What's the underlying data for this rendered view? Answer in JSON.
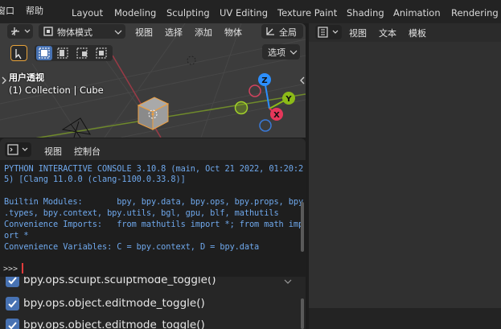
{
  "topbar": {
    "menus": [
      "窗口",
      "帮助"
    ],
    "workspaces": [
      "Layout",
      "Modeling",
      "Sculpting",
      "UV Editing",
      "Texture Paint",
      "Shading",
      "Animation",
      "Rendering"
    ]
  },
  "viewport": {
    "mode_label": "物体模式",
    "menus": [
      "视图",
      "选择",
      "添加",
      "物体"
    ],
    "global_label": "全局",
    "options_label": "选项",
    "view_name": "用户透视",
    "collection_info": "(1) Collection | Cube",
    "gizmo": {
      "z_label": "Z",
      "y_label": "Y",
      "x_label": "X"
    }
  },
  "console": {
    "menus": [
      "视图",
      "控制台"
    ],
    "lines": [
      "PYTHON INTERACTIVE CONSOLE 3.10.8 (main, Oct 21 2022, 01:20:2",
      "5) [Clang 11.0.0 (clang-1100.0.33.8)]",
      "",
      "Builtin Modules:       bpy, bpy.data, bpy.ops, bpy.props, bpy",
      ".types, bpy.context, bpy.utils, bgl, gpu, blf, mathutils",
      "Convenience Imports:   from mathutils import *; from math imp",
      "ort *",
      "Convenience Variables: C = bpy.context, D = bpy.data"
    ],
    "prompt": ">>>"
  },
  "history": {
    "items": [
      "bpy.ops.sculpt.sculptmode_toggle()",
      "bpy.ops.object.editmode_toggle()",
      "bpy.ops.object.editmode_toggle()"
    ]
  },
  "text_editor": {
    "menus": [
      "视图",
      "文本",
      "模板"
    ]
  },
  "colors": {
    "accent": "#4772b3",
    "console_text": "#6fa8ec",
    "axis_x": "#e5375a",
    "axis_y": "#8cba18",
    "axis_z": "#2c8fff"
  }
}
